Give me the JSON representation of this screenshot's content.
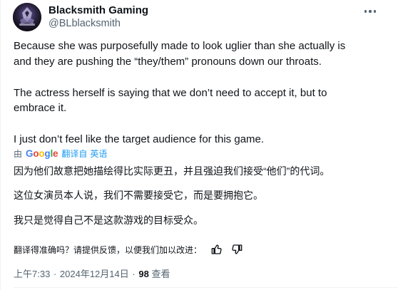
{
  "author": {
    "name": "Blacksmith Gaming",
    "handle": "@BLblacksmith"
  },
  "post": {
    "lines": [
      "Because she was purposefully made to look uglier than she actually is",
      "and they are pushing the “they/them” pronouns down our throats.",
      "The actress herself is saying that we don’t need to accept it, but to",
      "embrace it.",
      "I just don’t feel like the target audience for this game."
    ]
  },
  "translation": {
    "by_prefix": "由",
    "provider_letters": [
      "G",
      "o",
      "o",
      "g",
      "l",
      "e"
    ],
    "link_label": "翻译自",
    "source_language": "英语",
    "lines": [
      "因为他们故意把她描绘得比实际更丑，并且强迫我们接受“他们”的代词。",
      "这位女演员本人说，我们不需要接受它，而是要拥抱它。",
      "我只是觉得自己不是这款游戏的目标受众。"
    ],
    "feedback_prompt": "翻译得准确吗？请提供反馈，以便我们加以改进："
  },
  "meta": {
    "time": "上午7:33",
    "separator": "·",
    "date": "2024年12月14日",
    "views_count": "98",
    "views_label": "查看"
  },
  "icons": {
    "more": "more-horizontal-icon",
    "thumb_up": "thumbs-up-icon",
    "thumb_down": "thumbs-down-icon"
  },
  "colors": {
    "link": "#1d9bf0",
    "secondary_text": "#536471",
    "primary_text": "#0f1419"
  }
}
